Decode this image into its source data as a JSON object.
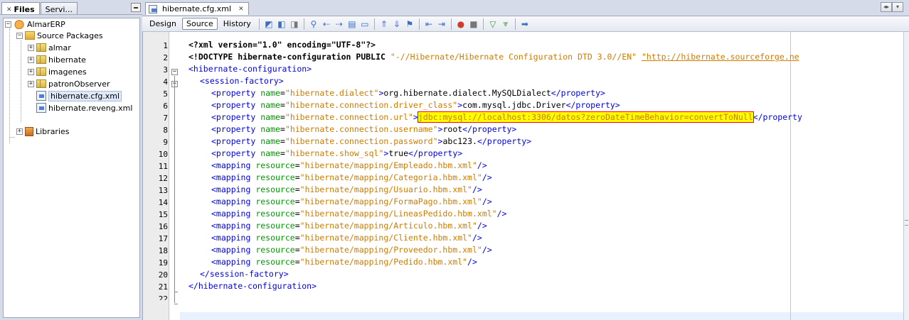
{
  "left_panel": {
    "tabs": [
      {
        "label": "Files",
        "active": true
      },
      {
        "label": "Servi...",
        "active": false
      }
    ],
    "tree": [
      {
        "label": "AlmarERP",
        "icon": "project-icon",
        "expander": "−"
      },
      {
        "label": "Source Packages",
        "icon": "source-packages-icon",
        "expander": "−"
      },
      {
        "label": "almar",
        "icon": "package-icon",
        "expander": "+"
      },
      {
        "label": "hibernate",
        "icon": "package-icon",
        "expander": "+"
      },
      {
        "label": "imagenes",
        "icon": "package-icon",
        "expander": "+"
      },
      {
        "label": "patronObserver",
        "icon": "package-icon",
        "expander": "+"
      },
      {
        "label": "hibernate.cfg.xml",
        "icon": "xml-file-icon",
        "expander": ""
      },
      {
        "label": "hibernate.reveng.xml",
        "icon": "xml-file-icon",
        "expander": ""
      },
      {
        "label": "Libraries",
        "icon": "libraries-icon",
        "expander": "+"
      }
    ]
  },
  "editor": {
    "tab_label": "hibernate.cfg.xml",
    "toolbar": {
      "design_label": "Design",
      "source_label": "Source",
      "history_label": "History"
    },
    "line_numbers": [
      "1",
      "2",
      "3",
      "4",
      "5",
      "6",
      "7",
      "8",
      "9",
      "10",
      "11",
      "12",
      "13",
      "14",
      "15",
      "16",
      "17",
      "18",
      "19",
      "20",
      "21",
      "22"
    ],
    "code": {
      "l1_text": "<?xml version=\"1.0\" encoding=\"UTF-8\"?>",
      "l2_doctype": "<!DOCTYPE hibernate-configuration PUBLIC ",
      "l2_public_id": "\"-//Hibernate/Hibernate Configuration DTD 3.0//EN\" ",
      "l2_system_id": "\"http://hibernate.sourceforge.ne",
      "l3_tag": "<hibernate-configuration>",
      "l4_tag": "<session-factory>",
      "properties": [
        {
          "name": "\"hibernate.dialect\"",
          "value": "org.hibernate.dialect.MySQLDialect"
        },
        {
          "name": "\"hibernate.connection.driver_class\"",
          "value": "com.mysql.jdbc.Driver"
        },
        {
          "name": "\"hibernate.connection.url\"",
          "value": "jdbc:mysql://localhost:3306/datos?zeroDateTimeBehavior=convertToNull"
        },
        {
          "name": "\"hibernate.connection.username\"",
          "value": "root"
        },
        {
          "name": "\"hibernate.connection.password\"",
          "value": "abc123."
        },
        {
          "name": "\"hibernate.show_sql\"",
          "value": "true"
        }
      ],
      "mappings": [
        "\"hibernate/mapping/Empleado.hbm.xml\"",
        "\"hibernate/mapping/Categoria.hbm.xml\"",
        "\"hibernate/mapping/Usuario.hbm.xml\"",
        "\"hibernate/mapping/FormaPago.hbm.xml\"",
        "\"hibernate/mapping/LineasPedido.hbm.xml\"",
        "\"hibernate/mapping/Articulo.hbm.xml\"",
        "\"hibernate/mapping/Cliente.hbm.xml\"",
        "\"hibernate/mapping/Proveedor.hbm.xml\"",
        "\"hibernate/mapping/Pedido.hbm.xml\""
      ],
      "l20_tag": "</session-factory>",
      "l21_tag": "</hibernate-configuration>",
      "prop_open": "<property ",
      "prop_name_attr": "name",
      "prop_eq": "=",
      "prop_gt": ">",
      "prop_close": "</property>",
      "prop_close_trunc": "</property",
      "map_open": "<mapping ",
      "map_attr": "resource",
      "map_end": "/>"
    }
  },
  "colors": {
    "tag": "#0000e6",
    "attr": "#009900",
    "value": "#ce7b00",
    "highlight": "#ffff00"
  }
}
